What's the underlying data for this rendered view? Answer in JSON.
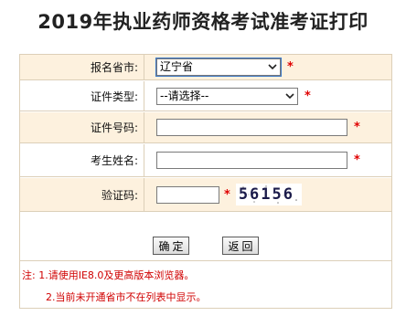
{
  "page": {
    "title": "2019年执业药师资格考试准考证打印"
  },
  "form": {
    "province": {
      "label": "报名省市:",
      "selected": "辽宁省"
    },
    "id_type": {
      "label": "证件类型:",
      "selected": "--请选择--"
    },
    "id_number": {
      "label": "证件号码:",
      "value": ""
    },
    "name": {
      "label": "考生姓名:",
      "value": ""
    },
    "captcha": {
      "label": "验证码:",
      "value": "",
      "image_text": "56156"
    },
    "required_mark": "*"
  },
  "buttons": {
    "confirm": "确定",
    "back": "返回"
  },
  "notes": {
    "line1": "注: 1.请使用IE8.0及更高版本浏览器。",
    "line2": "2.当前未开通省市不在列表中显示。"
  },
  "colors": {
    "label_bg": "#fdf1de",
    "border": "#dccfb8",
    "required": "#e00000",
    "note_text": "#d00000"
  }
}
